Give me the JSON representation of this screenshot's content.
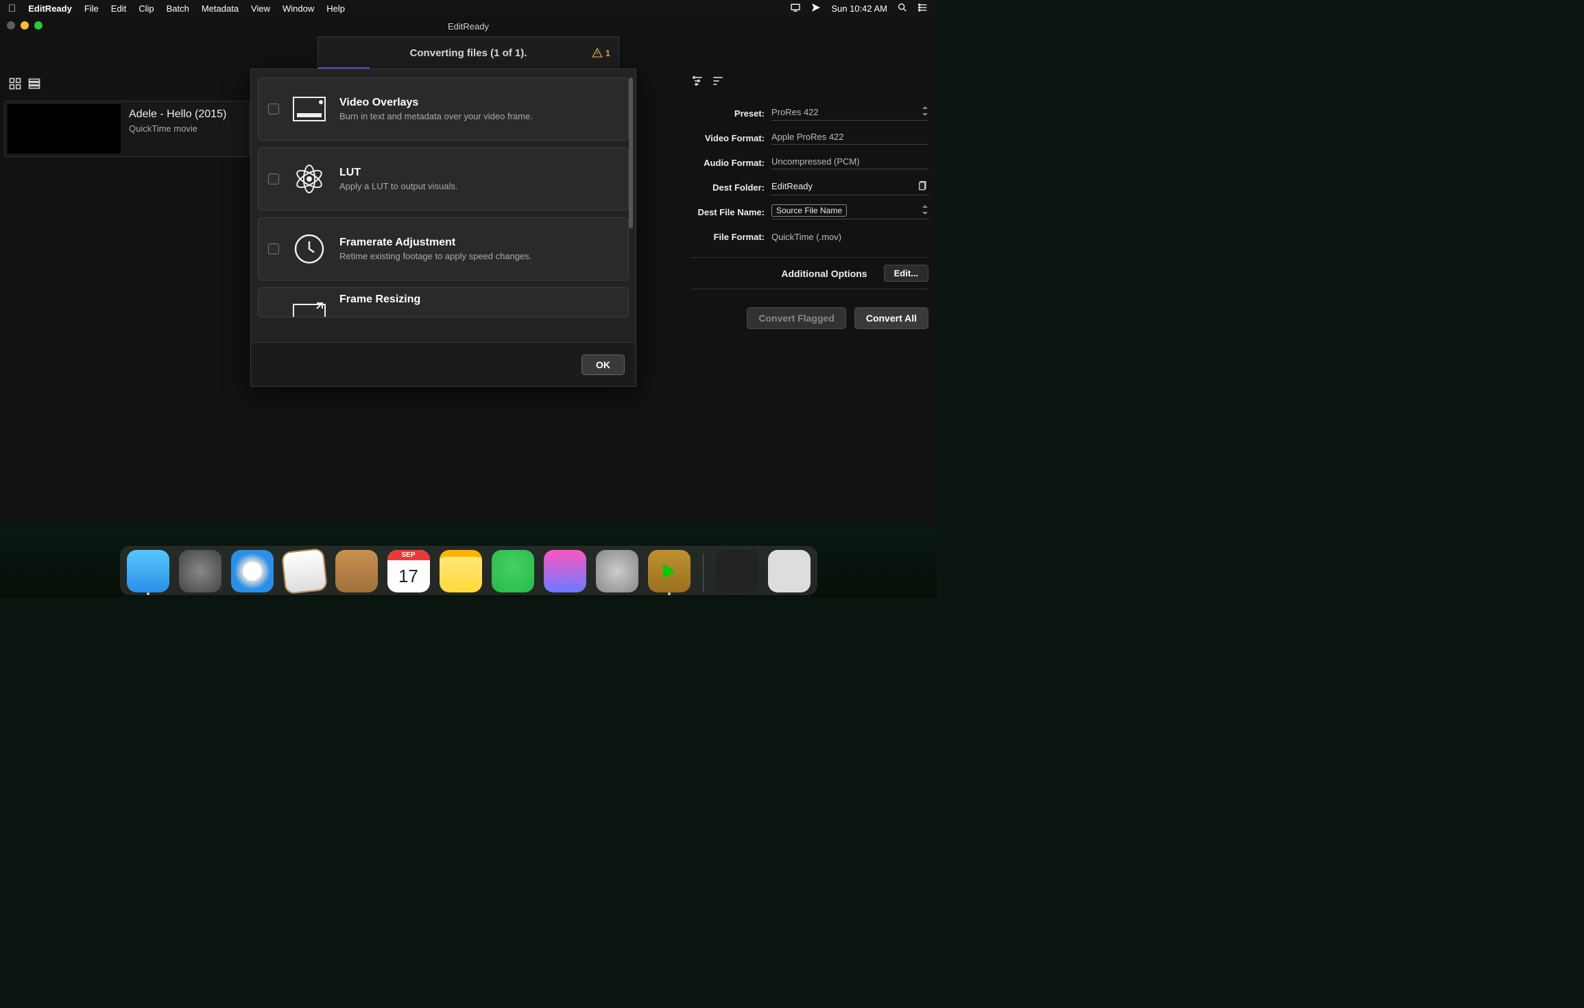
{
  "menubar": {
    "appname": "EditReady",
    "items": [
      "File",
      "Edit",
      "Clip",
      "Batch",
      "Metadata",
      "View",
      "Window",
      "Help"
    ],
    "clock": "Sun 10:42 AM"
  },
  "window": {
    "title": "EditReady",
    "status_text": "Converting files (1 of 1).",
    "warning_count": "1"
  },
  "clip": {
    "title": "Adele - Hello (2015)",
    "subtype": "QuickTime movie"
  },
  "settings": {
    "preset": {
      "label": "Preset:",
      "value": "ProRes 422"
    },
    "video_format": {
      "label": "Video Format:",
      "value": "Apple ProRes 422"
    },
    "audio_format": {
      "label": "Audio Format:",
      "value": "Uncompressed (PCM)"
    },
    "dest_folder": {
      "label": "Dest Folder:",
      "value": "EditReady"
    },
    "dest_filename": {
      "label": "Dest File Name:",
      "value": "Source File Name"
    },
    "file_format": {
      "label": "File Format:",
      "value": "QuickTime (.mov)"
    },
    "additional_options_label": "Additional Options",
    "edit_button": "Edit...",
    "convert_flagged": "Convert Flagged",
    "convert_all": "Convert All"
  },
  "modal": {
    "options": [
      {
        "title": "Video Overlays",
        "desc": "Burn in text and metadata over your video frame."
      },
      {
        "title": "LUT",
        "desc": "Apply a LUT to output visuals."
      },
      {
        "title": "Framerate Adjustment",
        "desc": "Retime existing footage to apply speed changes."
      },
      {
        "title": "Frame Resizing",
        "desc": ""
      }
    ],
    "ok": "OK"
  },
  "dock": {
    "cal_month": "SEP",
    "cal_day": "17"
  }
}
